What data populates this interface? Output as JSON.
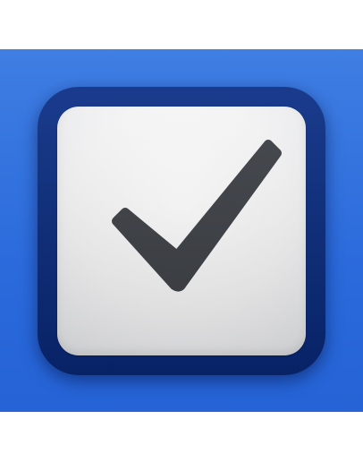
{
  "app_icon": {
    "icon": "checkmark-icon",
    "colors": {
      "background_blue": "#2b6bdc",
      "frame_navy": "#0b2d80",
      "paper_white": "#f6f6f7",
      "check_charcoal": "#3d4046"
    }
  }
}
